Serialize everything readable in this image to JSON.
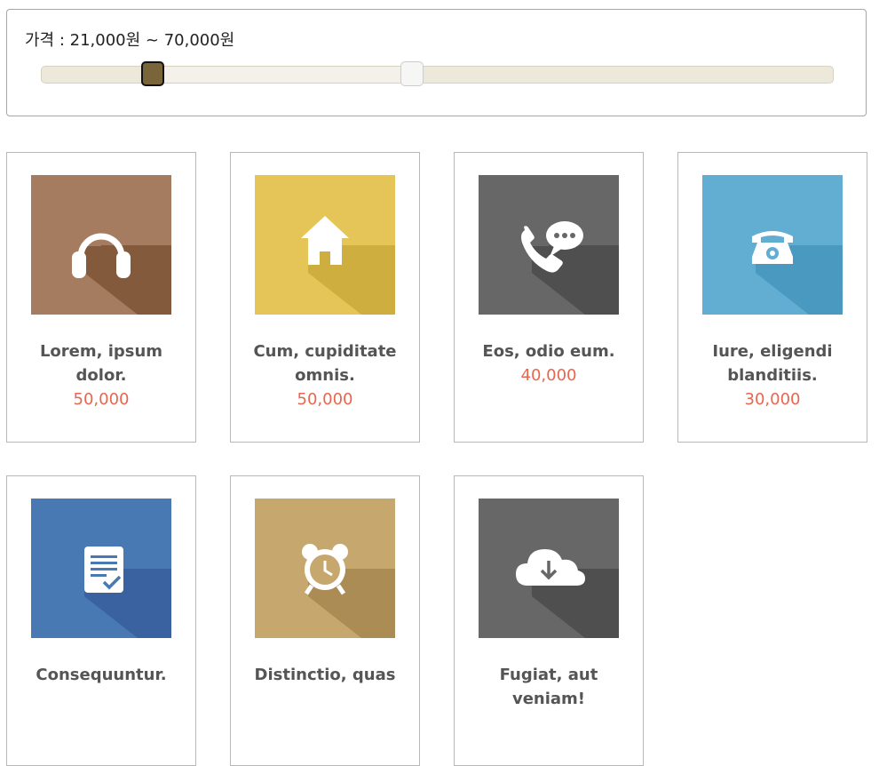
{
  "filter": {
    "label": "가격 : 21,000원 ~ 70,000원",
    "min_value": 21000,
    "max_value": 70000,
    "range_min": 0,
    "range_max": 150000
  },
  "products": [
    {
      "title": "Lorem, ipsum dolor.",
      "price": "50,000",
      "icon": "headphones-icon",
      "color": "#a67c60",
      "shadow": "#835a3b"
    },
    {
      "title": "Cum, cupiditate omnis.",
      "price": "50,000",
      "icon": "home-icon",
      "color": "#e5c557",
      "shadow": "#cdae3f"
    },
    {
      "title": "Eos, odio eum.",
      "price": "40,000",
      "icon": "phone-chat-icon",
      "color": "#676767",
      "shadow": "#4f4f4f"
    },
    {
      "title": "Iure, eligendi blanditiis.",
      "price": "30,000",
      "icon": "telephone-icon",
      "color": "#62aed2",
      "shadow": "#4a99c0"
    },
    {
      "title": "Consequuntur.",
      "price": "",
      "icon": "document-check-icon",
      "color": "#4879b3",
      "shadow": "#3a62a0"
    },
    {
      "title": "Distinctio, quas",
      "price": "",
      "icon": "alarm-clock-icon",
      "color": "#c6a76e",
      "shadow": "#ab8c55"
    },
    {
      "title": "Fugiat, aut veniam!",
      "price": "",
      "icon": "cloud-download-icon",
      "color": "#676767",
      "shadow": "#4f4f4f"
    }
  ]
}
